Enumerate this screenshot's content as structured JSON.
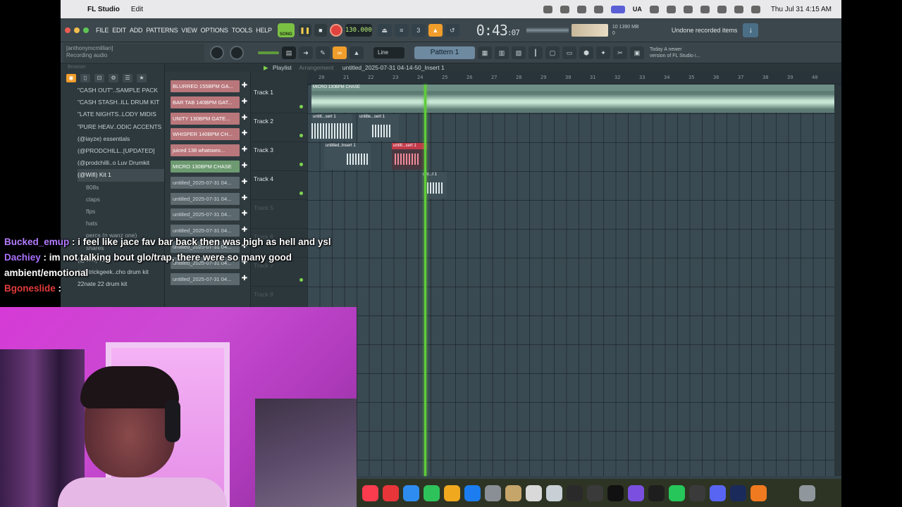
{
  "menubar": {
    "app_name": "FL Studio",
    "menu_edit": "Edit",
    "clock": "Thu Jul 31  4:15 AM",
    "status_icons": [
      "ua-label"
    ],
    "ua_label": "UA"
  },
  "fl_toolbar": {
    "menus": [
      "FILE",
      "EDIT",
      "ADD",
      "PATTERNS",
      "VIEW",
      "OPTIONS",
      "TOOLS",
      "HELP"
    ],
    "song_label": "SONG",
    "bpm": "130.000",
    "time": "0:43",
    "time_small": ":07",
    "cpu_line1": "10      1390 MB",
    "cpu_line2": "0",
    "hint": "Undone recorded items",
    "hint_panel_line1": "[anthonymcmillian]",
    "hint_panel_line2": "Recording audio",
    "snap": "Line",
    "pattern": "Pattern 1",
    "news_line1": "Today  A newer",
    "news_line2": "version of FL Studio i..."
  },
  "browser": {
    "header": "Browser",
    "items": [
      {
        "label": "\"CASH OUT\"..SAMPLE PACK",
        "type": "folder"
      },
      {
        "label": "\"CASH STASH..ILL DRUM KIT",
        "type": "folder"
      },
      {
        "label": "\"LATE NIGHTS..LODY MIDIS",
        "type": "folder"
      },
      {
        "label": "\"PURE HEAV..ODIC ACCENTS",
        "type": "folder"
      },
      {
        "label": "(@iayze) essentials",
        "type": "folder"
      },
      {
        "label": "(@PRODCHILL..[UPDATED]",
        "type": "folder"
      },
      {
        "label": "(@prodchilli..o Luv Drumkit",
        "type": "folder"
      },
      {
        "label": "(@Wifi) Kit 1",
        "type": "folder-open"
      },
      {
        "label": "808s",
        "type": "sub"
      },
      {
        "label": "claps",
        "type": "sub"
      },
      {
        "label": "flps",
        "type": "sub"
      },
      {
        "label": "hats",
        "type": "sub"
      },
      {
        "label": "percs (n wanz one)",
        "type": "sub"
      },
      {
        "label": "shares",
        "type": "sub"
      },
      {
        "label": "(@Wifi) Kit 2",
        "type": "folder"
      },
      {
        "label": "!! @trickgeek..cho drum kit",
        "type": "folder"
      },
      {
        "label": "22nate 22 drum kit",
        "type": "folder"
      }
    ]
  },
  "picker": {
    "items": [
      {
        "label": "BLURRED 155BPM GA...",
        "color": "red"
      },
      {
        "label": "BAR TAB 140BPM GAT...",
        "color": "red"
      },
      {
        "label": "UNITY 130BPM GATE...",
        "color": "red"
      },
      {
        "label": "WHISPER 140BPM CH...",
        "color": "red"
      },
      {
        "label": "juiced 138 whatswro...",
        "color": "red"
      },
      {
        "label": "MICRO 130BPM CHASE",
        "color": "green"
      },
      {
        "label": "untitled_2025-07-31 04...",
        "color": "gray"
      },
      {
        "label": "untitled_2025-07-31 04...",
        "color": "gray"
      },
      {
        "label": "untitled_2025-07-31 04...",
        "color": "gray"
      },
      {
        "label": "untitled_2025-07-31 04...",
        "color": "gray"
      },
      {
        "label": "untitled_2025-07-31 04...",
        "color": "gray"
      },
      {
        "label": "untitled_2025-07-31 04...",
        "color": "gray"
      },
      {
        "label": "untitled_2025-07-31 04...",
        "color": "gray"
      }
    ]
  },
  "playlist": {
    "title": "Playlist",
    "breadcrumb_sub": "Arrangement",
    "breadcrumb_file": "untitled_2025-07-31 04-14-50_Insert 1",
    "ruler_marks": [
      "20",
      "21",
      "22",
      "23",
      "24",
      "25",
      "26",
      "27",
      "28",
      "29",
      "30",
      "31",
      "32",
      "33",
      "34",
      "35",
      "36",
      "37",
      "38",
      "39",
      "40"
    ],
    "tracks": [
      "Track 1",
      "Track 2",
      "Track 3",
      "Track 4",
      "Track 5",
      "Track 6",
      "Track 7",
      "Track 8"
    ],
    "clips": {
      "micro": "MICRO 130BPM CHASE",
      "t2a": "untitl...sert 1",
      "t2b": "untitle...sert 1",
      "t3a": "untitled..Insert 1",
      "t3b": "untitl...sert 1",
      "t4a": "unt...t 1"
    }
  },
  "chat": [
    {
      "user": "Bucked_emup",
      "message": ": i feel like jace fav bar back then was high as hell and ysl",
      "user_color": "#b47cff"
    },
    {
      "user": "Dachiey",
      "message": ": im not talking bout glo/trap, there were so many good ambient/emotional",
      "user_color": "#a970ff"
    },
    {
      "user": "Bgoneslide",
      "message": ":",
      "user_color": "#e23b3b"
    }
  ],
  "colors": {
    "accent_orange": "#f19d2b",
    "accent_green": "#7ac143",
    "clip_red": "#c23a4a",
    "playhead": "#5fcc3b"
  }
}
